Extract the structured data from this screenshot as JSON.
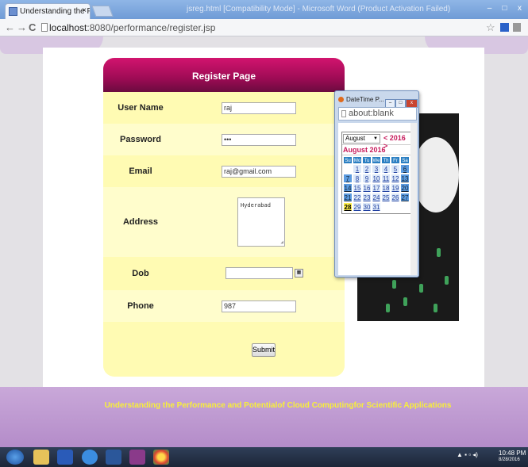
{
  "browser": {
    "tab_title": "Understanding the Perfo",
    "tab_close": "×",
    "window_title": "jsreg.html [Compatibility Mode] - Microsoft Word (Product Activation Failed)",
    "url_host": "localhost",
    "url_rest": ":8080/performance/register.jsp",
    "back": "←",
    "forward": "→",
    "reload": "C",
    "star": "☆",
    "minimize": "–",
    "maximize": "□",
    "close": "x"
  },
  "form": {
    "title": "Register Page",
    "username_label": "User Name",
    "username_value": "raj",
    "password_label": "Password",
    "password_value": "•••",
    "email_label": "Email",
    "email_value": "raj@gmail.com",
    "address_label": "Address",
    "address_value": "Hyderabad",
    "dob_label": "Dob",
    "dob_value": "",
    "phone_label": "Phone",
    "phone_value": "987",
    "submit_label": "Submit"
  },
  "popup": {
    "title": "DateTime P...",
    "address": "about:blank",
    "month_select": "August",
    "year_nav": "< 2016 >",
    "heading": "August 2016",
    "days_of_week": [
      "Su",
      "Mo",
      "Tu",
      "We",
      "Th",
      "Fr",
      "Sa"
    ],
    "weeks": [
      [
        "",
        "1",
        "2",
        "3",
        "4",
        "5",
        "6"
      ],
      [
        "7",
        "8",
        "9",
        "10",
        "11",
        "12",
        "13"
      ],
      [
        "14",
        "15",
        "16",
        "17",
        "18",
        "19",
        "20"
      ],
      [
        "21",
        "22",
        "23",
        "24",
        "25",
        "26",
        "27"
      ],
      [
        "28",
        "29",
        "30",
        "31",
        "",
        "",
        ""
      ]
    ],
    "today": "28"
  },
  "footer": {
    "text": "Understanding the Performance and Potentialof Cloud Computingfor Scientific Applications"
  },
  "taskbar": {
    "time": "10:48 PM",
    "date": "8/28/2016"
  }
}
